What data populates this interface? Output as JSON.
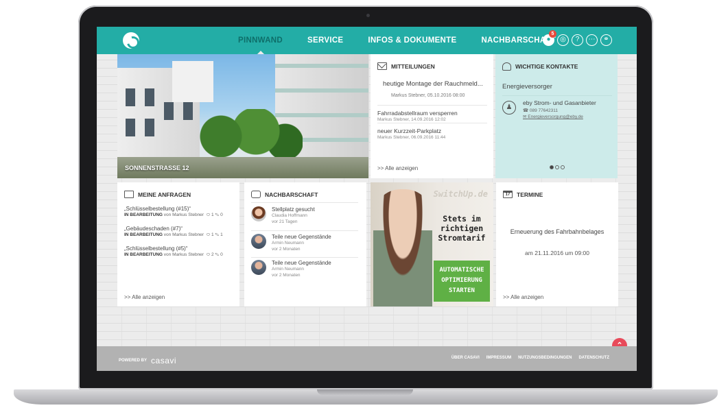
{
  "nav": {
    "items": [
      {
        "label": "PINNWAND",
        "active": true
      },
      {
        "label": "SERVICE",
        "active": false
      },
      {
        "label": "INFOS & DOKUMENTE",
        "active": false
      },
      {
        "label": "NACHBARSCHAFT",
        "active": false
      }
    ],
    "notification_count": "5",
    "icons": [
      "bell-icon",
      "globe-icon",
      "help-icon",
      "chat-icon",
      "user-icon"
    ]
  },
  "hero": {
    "caption": "SONNENSTRASSE 12"
  },
  "mitteilungen": {
    "title": "MITTEILUNGEN",
    "featured": {
      "title": "heutige Montage der Rauchmeld...",
      "meta": "Markus Stebner, 05.10.2016 08:00"
    },
    "items": [
      {
        "title": "Fahrradabstellraum versperren",
        "meta": "Markus Stebner, 14.09.2016 12:02"
      },
      {
        "title": "neuer Kurzzeit-Parkplatz",
        "meta": "Markus Stebner, 06.09.2016 11:44"
      }
    ],
    "show_all": ">> Alle anzeigen"
  },
  "kontakte": {
    "title": "WICHTIGE KONTAKTE",
    "category": "Energieversorger",
    "contact": {
      "name": "eby Strom- und Gasanbieter",
      "phone": "☎ 089 77642311",
      "email": "Energieversorgung@eby.de",
      "email_prefix": "✉ "
    },
    "pager": {
      "current": 1,
      "total": 3
    }
  },
  "anfragen": {
    "title": "MEINE ANFRAGEN",
    "items": [
      {
        "title": "„Schlüsselbestellung (#15)“",
        "status": "IN BEARBEITUNG",
        "by": " von Markus Stebner",
        "counts": "⬭ 1 ✎ 0"
      },
      {
        "title": "„Gebäudeschaden (#7)“",
        "status": "IN BEARBEITUNG",
        "by": " von Markus Stebner",
        "counts": "⬭ 1 ✎ 1"
      },
      {
        "title": "„Schlüsselbestellung (#5)“",
        "status": "IN BEARBEITUNG",
        "by": " von Markus Stebner",
        "counts": "⬭ 2 ✎ 0"
      }
    ],
    "show_all": ">> Alle anzeigen"
  },
  "nachbarschaft": {
    "title": "NACHBARSCHAFT",
    "items": [
      {
        "title": "Stellplatz gesucht",
        "author": "Claudia Hoffmann",
        "age": "vor 21 Tagen"
      },
      {
        "title": "Teile neue Gegenstände",
        "author": "Armin Neumann",
        "age": "vor 2 Monaten"
      },
      {
        "title": "Teile neue Gegenstände",
        "author": "Armin Neumann",
        "age": "vor 2 Monaten"
      }
    ]
  },
  "ad": {
    "brand": "SwitchUp.de",
    "headline_1": "Stets im",
    "headline_2": "richtigen",
    "headline_3": "Stromtarif",
    "cta_1": "AUTOMATISCHE",
    "cta_2": "OPTIMIERUNG",
    "cta_3": "STARTEN"
  },
  "termine": {
    "title": "TERMINE",
    "calendar_day": "17",
    "event_title": "Erneuerung des Fahrbahnbelages",
    "event_date": "am 21.11.2016 um 09:00",
    "show_all": ">> Alle anzeigen"
  },
  "footer": {
    "powered_by": "POWERED BY",
    "logo_text": "casavi",
    "links": [
      "ÜBER CASAVI",
      "IMPRESSUM",
      "NUTZUNGSBEDINGUNGEN",
      "DATENSCHUTZ"
    ]
  },
  "colors": {
    "accent": "#23ada6",
    "contacts_bg": "#cdebea",
    "cta_green": "#5fb045",
    "badge_red": "#e84a3c"
  }
}
